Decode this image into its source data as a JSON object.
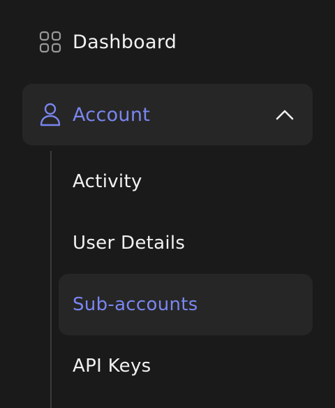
{
  "colors": {
    "background": "#1a1a1a",
    "active_background": "#262626",
    "accent": "#7a86f0",
    "text": "#f2f2f2",
    "tree_line": "#3a3a3a"
  },
  "nav": {
    "dashboard": {
      "label": "Dashboard",
      "icon": "grid-icon"
    },
    "account": {
      "label": "Account",
      "icon": "user-icon",
      "expanded": true,
      "toggle_icon": "chevron-up-icon"
    }
  },
  "account_submenu": [
    {
      "label": "Activity",
      "active": false
    },
    {
      "label": "User Details",
      "active": false
    },
    {
      "label": "Sub-accounts",
      "active": true
    },
    {
      "label": "API Keys",
      "active": false
    }
  ]
}
